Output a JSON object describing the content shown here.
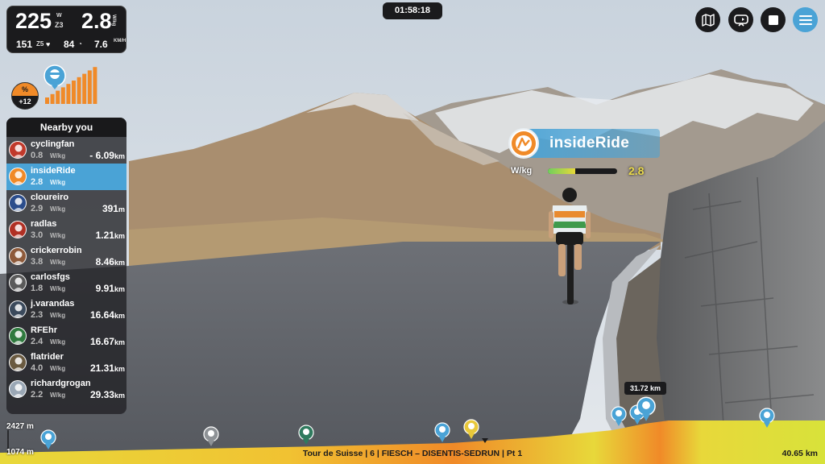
{
  "stats": {
    "power": "225",
    "power_unit": "W",
    "zone": "Z3",
    "wkg": "2.8",
    "wkg_unit": "W/kg",
    "heart_rate": "151",
    "hr_zone": "Z5",
    "cadence": "84",
    "speed": "7.6",
    "speed_unit": "KM/H"
  },
  "grade": {
    "symbol": "%",
    "value": "+12",
    "level_bars": 10
  },
  "nearby": {
    "title": "Nearby you",
    "riders": [
      {
        "name": "cyclingfan",
        "wkg": "0.8",
        "dist": "- 6.09",
        "me": false,
        "color": "#c0392b"
      },
      {
        "name": "insideRide",
        "wkg": "2.8",
        "dist": "",
        "me": true,
        "color": "#f08a28"
      },
      {
        "name": "cloureiro",
        "wkg": "2.9",
        "dist": "391",
        "unit": "m",
        "me": false,
        "color": "#2b4d8c"
      },
      {
        "name": "radlas",
        "wkg": "3.0",
        "dist": "1.21",
        "me": false,
        "color": "#b03024"
      },
      {
        "name": "crickerrobin",
        "wkg": "3.8",
        "dist": "8.46",
        "me": false,
        "color": "#8e5a3a"
      },
      {
        "name": "carlosfgs",
        "wkg": "1.8",
        "dist": "9.91",
        "me": false,
        "color": "#5a5a5a"
      },
      {
        "name": "j.varandas",
        "wkg": "2.3",
        "dist": "16.64",
        "me": false,
        "color": "#3b4a5c"
      },
      {
        "name": "RFEhr",
        "wkg": "2.4",
        "dist": "16.67",
        "me": false,
        "color": "#2f7a3e"
      },
      {
        "name": "flatrider",
        "wkg": "4.0",
        "dist": "21.31",
        "me": false,
        "color": "#6a5a40"
      },
      {
        "name": "richardgrogan",
        "wkg": "2.2",
        "dist": "29.33",
        "me": false,
        "color": "#9aa7b5"
      }
    ],
    "wkg_unit": "W/kg",
    "dist_unit": "km"
  },
  "timer": "01:58:18",
  "toolbar": {
    "map_icon": "map-icon",
    "camera_icon": "camera-switch-icon",
    "stop_icon": "stop-icon",
    "menu_icon": "menu-icon"
  },
  "rider_tag": {
    "name": "insideRide",
    "wkg_label": "W/kg",
    "wkg_value": "2.8",
    "wkg_fraction": 0.4
  },
  "profile": {
    "elev_max": "2427 m",
    "elev_min": "1074 m",
    "route_title": "Tour de Suisse | 6 | FIESCH – DISENTIS-SEDRUN | Pt 1",
    "total_dist": "40.65 km",
    "current_dist": "31.72 km"
  },
  "colors": {
    "accent": "#4aa3d6",
    "panel": "#1b1b1d",
    "highlight": "#f08a28",
    "wkg_value": "#e8d84c"
  }
}
